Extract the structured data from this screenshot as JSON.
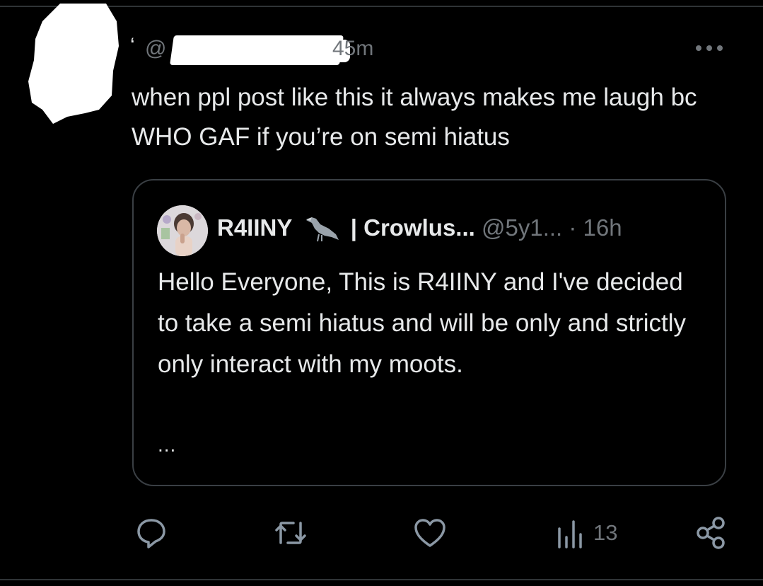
{
  "tweet": {
    "quote_mark": "‘",
    "handle_prefix": "@",
    "timestamp": "45m",
    "text": "when ppl post like this it always makes me laugh bc WHO GAF if you’re on semi hiatus"
  },
  "quoted": {
    "name": "R4IINY",
    "badge_icon": "crow-icon",
    "display_suffix": "| Crowlus...",
    "handle": "@5y1...",
    "separator": "·",
    "time": "16h",
    "body": "Hello Everyone, This is R4IINY and I've decided to take a semi hiatus and will be only and strictly only interact with my moots.",
    "ellipsis": "..."
  },
  "actions": {
    "reply_icon": "reply-icon",
    "retweet_icon": "retweet-icon",
    "like_icon": "heart-icon",
    "views_icon": "views-chart-icon",
    "views_count": "13",
    "share_icon": "share-icon"
  },
  "colors": {
    "background": "#000000",
    "text": "#e7e9ea",
    "secondary": "#71767b",
    "border": "#3a3f44"
  }
}
